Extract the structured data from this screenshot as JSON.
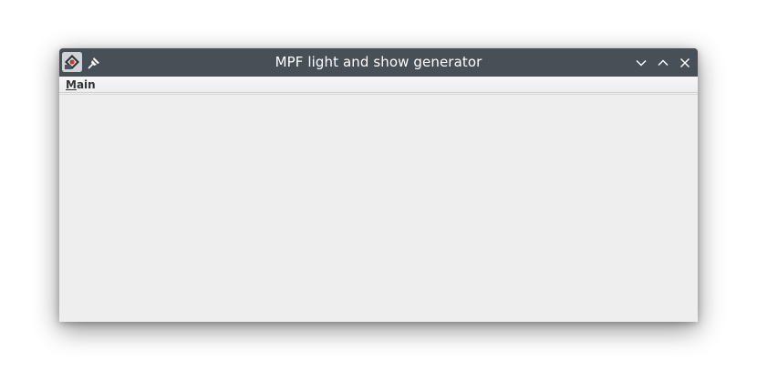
{
  "window": {
    "title": "MPF light and show generator",
    "app_icon": "application-icon",
    "controls": [
      "minimize-icon",
      "maximize-icon",
      "close-icon"
    ],
    "titlebar_color": "#475057",
    "background_color": "#eeeeee"
  },
  "menubar": {
    "items": [
      {
        "mnemonic": "M",
        "rest": "ain"
      }
    ]
  }
}
